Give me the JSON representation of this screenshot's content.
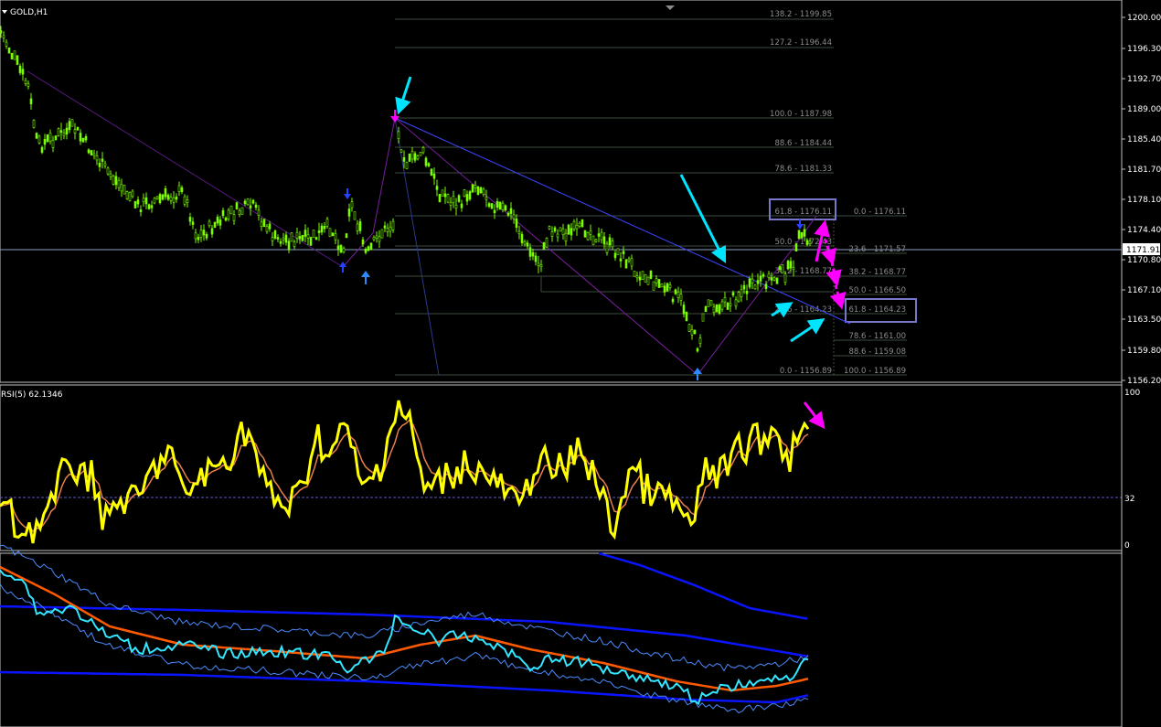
{
  "symbol": "GOLD,H1",
  "current_price": "1171.91",
  "price_axis": [
    "1200.00",
    "1196.30",
    "1192.70",
    "1189.00",
    "1185.40",
    "1181.70",
    "1178.10",
    "1174.40",
    "1170.80",
    "1167.10",
    "1163.50",
    "1159.80",
    "1156.20"
  ],
  "fib_left": [
    {
      "label": "138.2 - 1199.85"
    },
    {
      "label": "127.2 - 1196.44"
    },
    {
      "label": "100.0 - 1187.98"
    },
    {
      "label": "88.6 - 1184.44"
    },
    {
      "label": "78.6 - 1181.33"
    },
    {
      "label": "61.8 - 1176.11"
    },
    {
      "label": "50.0 - 1172.43"
    },
    {
      "label": "38.2 - 1168.77"
    },
    {
      "label": "23.6 - 1164.23"
    },
    {
      "label": "0.0 - 1156.89"
    }
  ],
  "fib_right": [
    {
      "label": "0.0 - 1176.11"
    },
    {
      "label": "23.6 - 1171.57"
    },
    {
      "label": "38.2 - 1168.77"
    },
    {
      "label": "50.0 - 1166.50"
    },
    {
      "label": "61.8 - 1164.23"
    },
    {
      "label": "78.6 - 1161.00"
    },
    {
      "label": "88.6 - 1159.08"
    },
    {
      "label": "100.0 - 1156.89"
    }
  ],
  "rsi": {
    "title": "RSI(5) 62.1346",
    "axis": [
      "100",
      "32",
      "0"
    ]
  },
  "colors": {
    "candle": "#7cfc00",
    "rsi": "#ffff00",
    "rsi_signal": "#e8804a",
    "bands": "#0000ff",
    "price_line": "#33e6ff",
    "ma": "#ff5a00",
    "fib_line": "#3c4a3c",
    "fib_box": "#7878c8",
    "trend": "#3c46ff",
    "zigzag": "#7a1fa0",
    "arrow_cyan": "#00e5ff",
    "arrow_magenta": "#ff00ff"
  }
}
